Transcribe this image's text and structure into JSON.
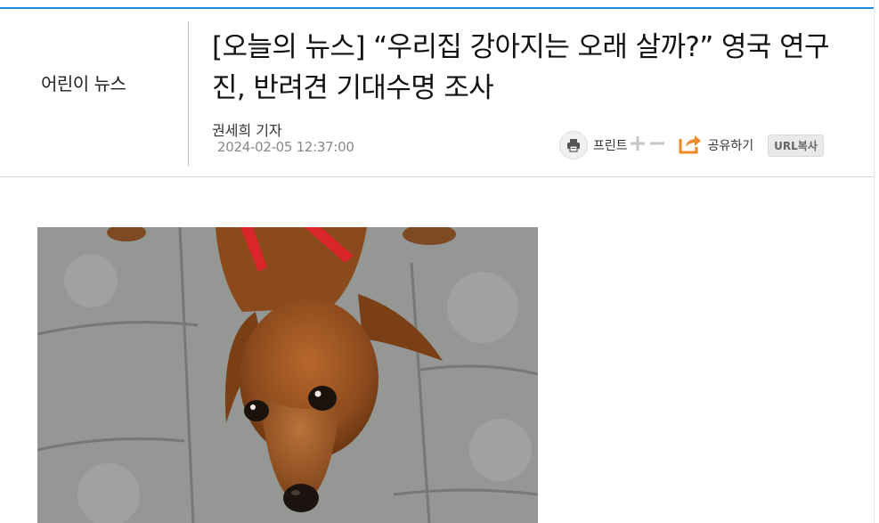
{
  "section": {
    "name": "어린이 뉴스"
  },
  "article": {
    "headline": "[오늘의 뉴스] “우리집 강아지는 오래 살까?” 영국 연구진, 반려견 기대수명 조사",
    "reporter": "권세희 기자",
    "datetime": "2024-02-05 12:37:00"
  },
  "tools": {
    "print_label": "프린트",
    "share_label": "공유하기",
    "url_copy_label": "URL복사"
  },
  "icons": {
    "print": "printer-icon",
    "font_increase": "plus-icon",
    "font_decrease": "minus-icon",
    "share": "share-icon"
  },
  "colors": {
    "top_bar": "#1f8fe0",
    "share_accent": "#f08a24"
  }
}
